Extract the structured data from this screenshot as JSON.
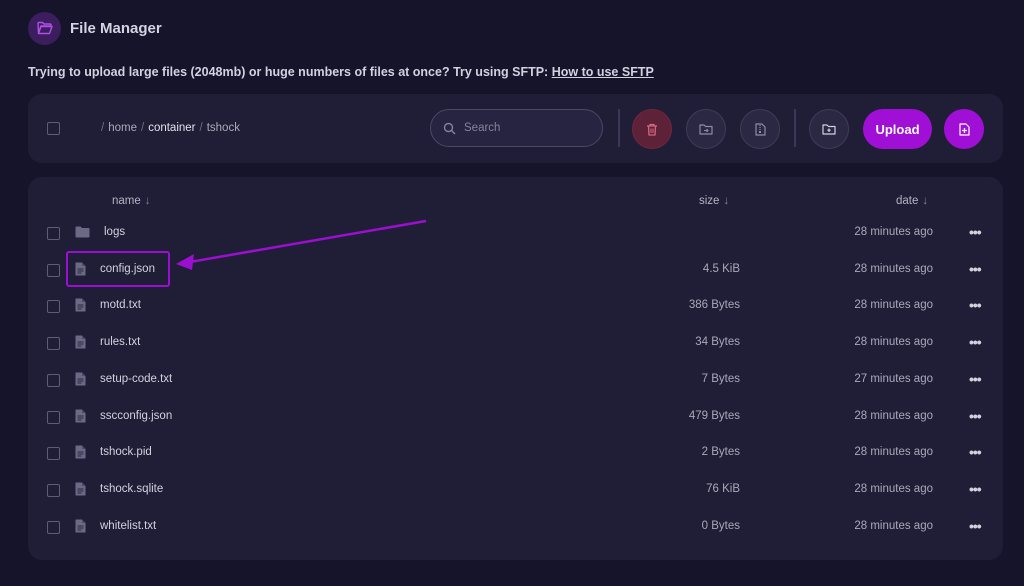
{
  "header": {
    "title": "File Manager",
    "icon": "folder-open-icon"
  },
  "notice": {
    "text": "Trying to upload large files (2048mb) or huge numbers of files at once? Try using SFTP:",
    "link_text": "How to use SFTP"
  },
  "breadcrumb": {
    "segments": [
      "home",
      "container"
    ],
    "current": "tshock"
  },
  "search": {
    "placeholder": "Search",
    "value": ""
  },
  "toolbar": {
    "upload_label": "Upload"
  },
  "table": {
    "columns": {
      "name": "name",
      "size": "size",
      "date": "date",
      "sort_arrow": "↓"
    },
    "rows": [
      {
        "type": "folder",
        "name": "logs",
        "size": "",
        "date": "28 minutes ago"
      },
      {
        "type": "file",
        "name": "config.json",
        "size": "4.5 KiB",
        "date": "28 minutes ago"
      },
      {
        "type": "file",
        "name": "motd.txt",
        "size": "386 Bytes",
        "date": "28 minutes ago"
      },
      {
        "type": "file",
        "name": "rules.txt",
        "size": "34 Bytes",
        "date": "28 minutes ago"
      },
      {
        "type": "file",
        "name": "setup-code.txt",
        "size": "7 Bytes",
        "date": "27 minutes ago"
      },
      {
        "type": "file",
        "name": "sscconfig.json",
        "size": "479 Bytes",
        "date": "28 minutes ago"
      },
      {
        "type": "file",
        "name": "tshock.pid",
        "size": "2 Bytes",
        "date": "28 minutes ago"
      },
      {
        "type": "file",
        "name": "tshock.sqlite",
        "size": "76 KiB",
        "date": "28 minutes ago"
      },
      {
        "type": "file",
        "name": "whitelist.txt",
        "size": "0 Bytes",
        "date": "28 minutes ago"
      }
    ],
    "more_glyph": "•••"
  },
  "colors": {
    "background": "#16142a",
    "panel": "#201e36",
    "accent": "#a00fd6",
    "delete": "#5d2238",
    "annotation": "#9a0fd0"
  }
}
